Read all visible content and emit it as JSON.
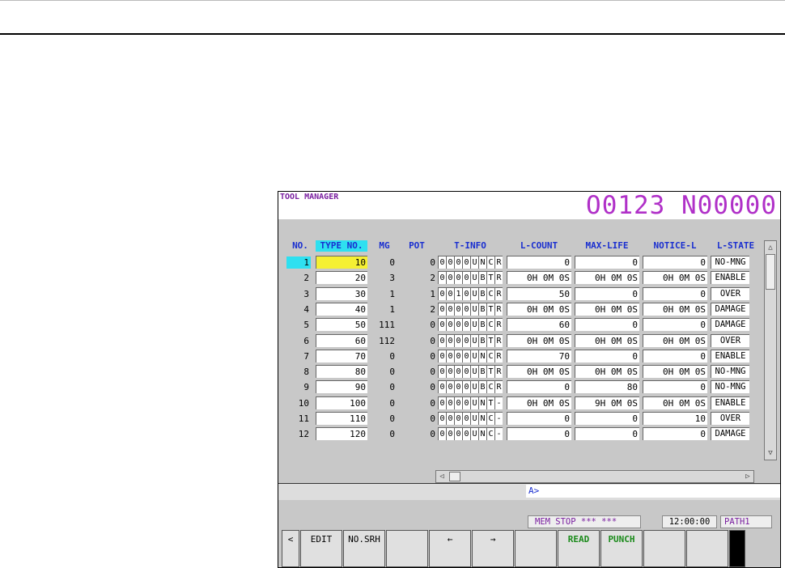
{
  "screen": {
    "title": "TOOL MANAGER",
    "program_number": "O0123 N00000"
  },
  "columns": {
    "no": "NO.",
    "type_no": "TYPE NO.",
    "mg": "MG",
    "pot": "POT",
    "t_info": "T-INFO",
    "l_count": "L-COUNT",
    "max_life": "MAX-LIFE",
    "notice_l": "NOTICE-L",
    "l_state": "L-STATE"
  },
  "rows": [
    {
      "no": "1",
      "type_no": "10",
      "mg": "0",
      "pot": "0",
      "tinfo": [
        "0",
        "0",
        "0",
        "0",
        "U",
        "N",
        "C",
        "R"
      ],
      "l_count": "0",
      "max_life": "0",
      "notice_l": "0",
      "l_state": "NO-MNG"
    },
    {
      "no": "2",
      "type_no": "20",
      "mg": "3",
      "pot": "2",
      "tinfo": [
        "0",
        "0",
        "0",
        "0",
        "U",
        "B",
        "T",
        "R"
      ],
      "l_count": "0H  0M  0S",
      "max_life": "0H  0M  0S",
      "notice_l": "0H  0M  0S",
      "l_state": "ENABLE"
    },
    {
      "no": "3",
      "type_no": "30",
      "mg": "1",
      "pot": "1",
      "tinfo": [
        "0",
        "0",
        "1",
        "0",
        "U",
        "B",
        "C",
        "R"
      ],
      "l_count": "50",
      "max_life": "0",
      "notice_l": "0",
      "l_state": "OVER"
    },
    {
      "no": "4",
      "type_no": "40",
      "mg": "1",
      "pot": "2",
      "tinfo": [
        "0",
        "0",
        "0",
        "0",
        "U",
        "B",
        "T",
        "R"
      ],
      "l_count": "0H  0M  0S",
      "max_life": "0H  0M  0S",
      "notice_l": "0H  0M  0S",
      "l_state": "DAMAGE"
    },
    {
      "no": "5",
      "type_no": "50",
      "mg": "111",
      "pot": "0",
      "tinfo": [
        "0",
        "0",
        "0",
        "0",
        "U",
        "B",
        "C",
        "R"
      ],
      "l_count": "60",
      "max_life": "0",
      "notice_l": "0",
      "l_state": "DAMAGE"
    },
    {
      "no": "6",
      "type_no": "60",
      "mg": "112",
      "pot": "0",
      "tinfo": [
        "0",
        "0",
        "0",
        "0",
        "U",
        "B",
        "T",
        "R"
      ],
      "l_count": "0H  0M  0S",
      "max_life": "0H  0M  0S",
      "notice_l": "0H  0M  0S",
      "l_state": "OVER"
    },
    {
      "no": "7",
      "type_no": "70",
      "mg": "0",
      "pot": "0",
      "tinfo": [
        "0",
        "0",
        "0",
        "0",
        "U",
        "N",
        "C",
        "R"
      ],
      "l_count": "70",
      "max_life": "0",
      "notice_l": "0",
      "l_state": "ENABLE"
    },
    {
      "no": "8",
      "type_no": "80",
      "mg": "0",
      "pot": "0",
      "tinfo": [
        "0",
        "0",
        "0",
        "0",
        "U",
        "B",
        "T",
        "R"
      ],
      "l_count": "0H  0M  0S",
      "max_life": "0H  0M  0S",
      "notice_l": "0H  0M  0S",
      "l_state": "NO-MNG"
    },
    {
      "no": "9",
      "type_no": "90",
      "mg": "0",
      "pot": "0",
      "tinfo": [
        "0",
        "0",
        "0",
        "0",
        "U",
        "B",
        "C",
        "R"
      ],
      "l_count": "0",
      "max_life": "80",
      "notice_l": "0",
      "l_state": "NO-MNG"
    },
    {
      "no": "10",
      "type_no": "100",
      "mg": "0",
      "pot": "0",
      "tinfo": [
        "0",
        "0",
        "0",
        "0",
        "U",
        "N",
        "T",
        "-"
      ],
      "l_count": "0H  0M  0S",
      "max_life": "9H  0M  0S",
      "notice_l": "0H  0M  0S",
      "l_state": "ENABLE"
    },
    {
      "no": "11",
      "type_no": "110",
      "mg": "0",
      "pot": "0",
      "tinfo": [
        "0",
        "0",
        "0",
        "0",
        "U",
        "N",
        "C",
        "-"
      ],
      "l_count": "0",
      "max_life": "0",
      "notice_l": "10",
      "l_state": "OVER"
    },
    {
      "no": "12",
      "type_no": "120",
      "mg": "0",
      "pot": "0",
      "tinfo": [
        "0",
        "0",
        "0",
        "0",
        "U",
        "N",
        "C",
        "-"
      ],
      "l_count": "0",
      "max_life": "0",
      "notice_l": "0",
      "l_state": "DAMAGE"
    }
  ],
  "scroll": {
    "up": "△",
    "down": "▽",
    "left": "◁",
    "right": "▷"
  },
  "input": {
    "prompt": "A>"
  },
  "status": {
    "mode": "MEM  STOP *** ***",
    "time": "12:00:00",
    "path": "PATH1"
  },
  "softkeys": [
    {
      "label": "<"
    },
    {
      "label": "EDIT"
    },
    {
      "label": "NO.SRH"
    },
    {
      "label": ""
    },
    {
      "label": "←"
    },
    {
      "label": "→"
    },
    {
      "label": ""
    },
    {
      "label": "READ"
    },
    {
      "label": "PUNCH"
    },
    {
      "label": ""
    },
    {
      "label": ""
    },
    {
      "label": ""
    }
  ],
  "colors": {
    "header_text": "#1a2fd0",
    "selected_header_bg": "#2ee0f0",
    "selected_cell_bg": "#f5f033",
    "title_text": "#7a1fa0",
    "program_number": "#b030c8",
    "softkey_green": "#1a8a1a"
  }
}
